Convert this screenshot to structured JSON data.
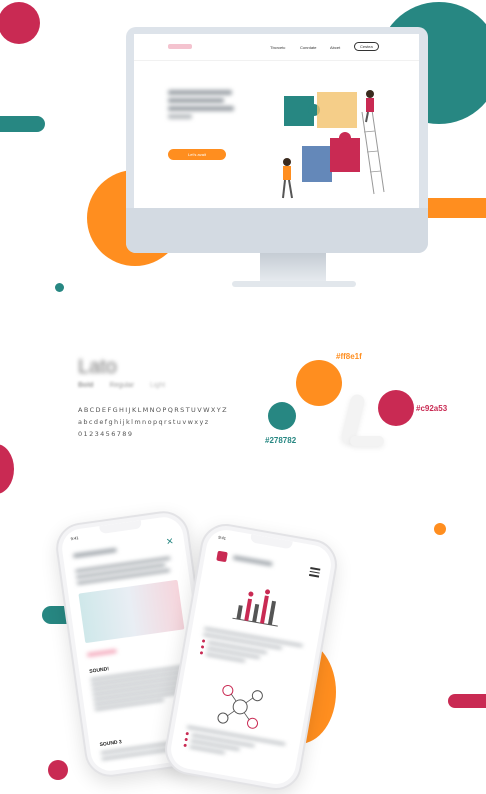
{
  "colors": {
    "orange": "#ff8e1f",
    "crimson": "#c92a53",
    "teal": "#278782"
  },
  "desktop": {
    "nav": {
      "links": [
        "Tbcrcetc",
        "Conrdate",
        "Abcet"
      ],
      "button_label": "Cestea"
    },
    "cta_label": "Let's avait"
  },
  "typography": {
    "font_name": "Lato",
    "weights": [
      "Bold",
      "Regular",
      "Light"
    ],
    "uppercase": "ABCDEFGHIJKLMNOPQRSTUVWXYZ",
    "lowercase": "abcdefghijklmnopqrstuvwxyz",
    "digits": "0123456789"
  },
  "palette": {
    "orange_hex": "#ff8e1f",
    "crimson_hex": "#c92a53",
    "teal_hex": "#278782"
  },
  "phone_left": {
    "time": "9:41",
    "section1_title": "SOUND!",
    "section2_title": "SOUND 3"
  },
  "phone_right": {
    "time": "9:41"
  },
  "icons": [
    "close-icon",
    "hamburger-menu-icon",
    "chart-icon",
    "network-icon",
    "puzzle-icon"
  ]
}
